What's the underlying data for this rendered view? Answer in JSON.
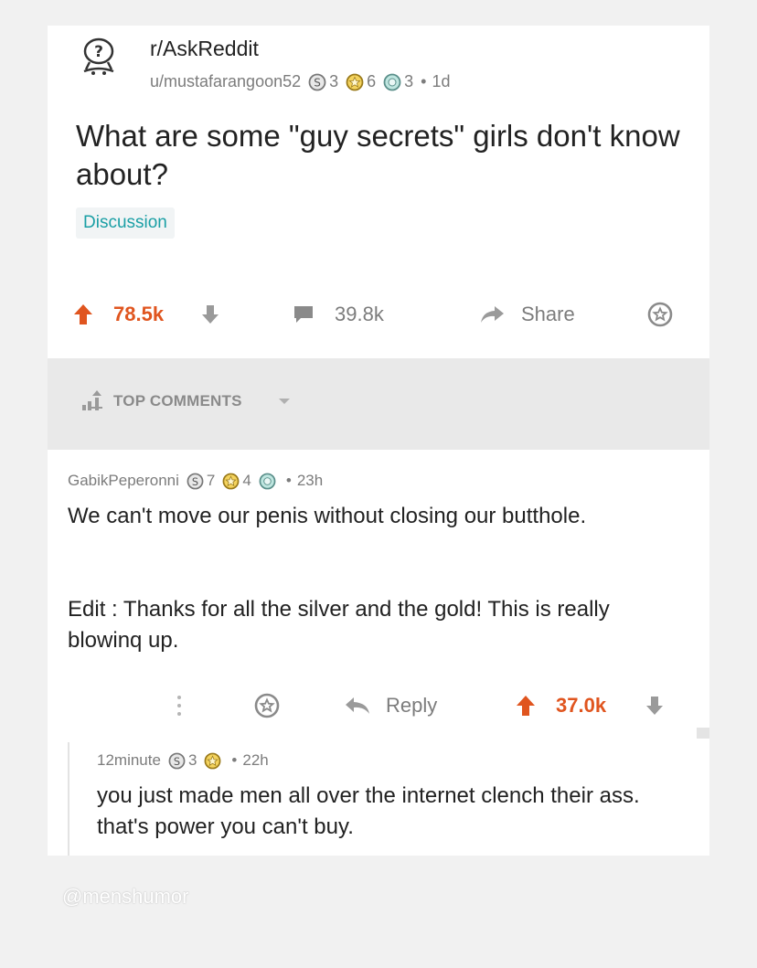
{
  "post": {
    "subreddit": "r/AskReddit",
    "author": "u/mustafarangoon52",
    "awards": {
      "silver": "3",
      "gold": "6",
      "platinum": "3"
    },
    "age": "1d",
    "title": "What are some \"guy secrets\" girls don't know about?",
    "flair": "Discussion",
    "score": "78.5k",
    "comments_count": "39.8k",
    "share_label": "Share"
  },
  "sort": {
    "label": "TOP COMMENTS"
  },
  "comment": {
    "author": "GabikPeperonni",
    "awards": {
      "silver": "7",
      "gold": "4"
    },
    "age": "23h",
    "body_line1": "We can't move our penis without closing our butthole.",
    "body_line2": "Edit : Thanks for all the silver and the gold! This is really blowinq up.",
    "reply_label": "Reply",
    "score": "37.0k"
  },
  "reply": {
    "author": "12minute",
    "awards": {
      "silver": "3"
    },
    "age": "22h",
    "body": "you just made men all over the internet clench their ass. that's power you can't buy."
  },
  "watermark": "@menshumor",
  "colors": {
    "upvote": "#e0551f",
    "flair": "#1a9fa5",
    "meta": "#7c7c7c"
  },
  "icons": [
    "subreddit-avatar-icon",
    "silver-award-icon",
    "gold-award-icon",
    "platinum-award-icon",
    "upvote-icon",
    "downvote-icon",
    "comment-icon",
    "share-icon",
    "save-icon",
    "sort-icon",
    "chevron-down-icon",
    "more-icon",
    "reply-icon"
  ]
}
